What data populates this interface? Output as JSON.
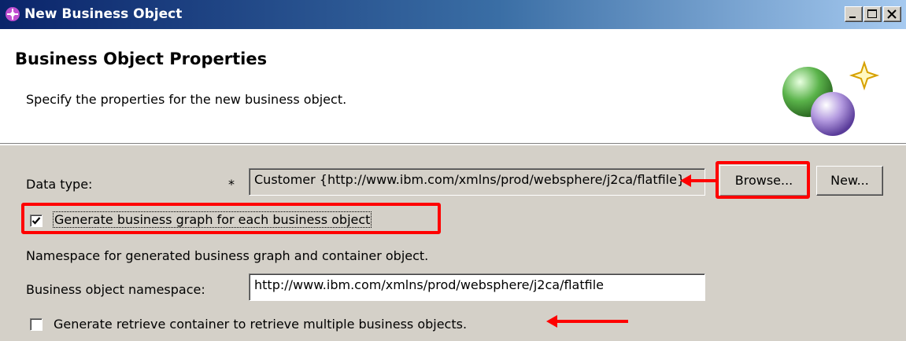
{
  "window": {
    "title": "New Business Object"
  },
  "header": {
    "title": "Business Object Properties",
    "subtitle": "Specify the properties for the new business object."
  },
  "form": {
    "data_type_label": "Data type:",
    "required_marker": "*",
    "data_type_value": "Customer  {http://www.ibm.com/xmlns/prod/websphere/j2ca/flatfile}",
    "browse_label": "Browse...",
    "new_label": "New...",
    "generate_graph_label": "Generate business graph for each business object",
    "generate_graph_checked": true,
    "namespace_note": "Namespace for generated business graph and container object.",
    "bo_namespace_label": "Business object namespace:",
    "bo_namespace_value": "http://www.ibm.com/xmlns/prod/websphere/j2ca/flatfile",
    "retrieve_container_label": "Generate retrieve container to retrieve multiple business objects.",
    "retrieve_container_checked": false
  },
  "annotations": {
    "highlight_color": "#ff0000"
  }
}
